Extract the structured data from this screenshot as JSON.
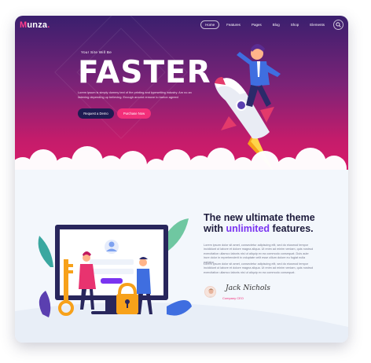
{
  "brand": {
    "logo": "unza",
    "logo_initial": "M",
    "logo_dot": "."
  },
  "nav": {
    "items": [
      {
        "label": "Home",
        "active": true
      },
      {
        "label": "Features",
        "active": false
      },
      {
        "label": "Pages",
        "active": false
      },
      {
        "label": "Blog",
        "active": false
      },
      {
        "label": "Shop",
        "active": false
      },
      {
        "label": "Elements",
        "active": false
      }
    ],
    "search_icon": "search-icon"
  },
  "hero": {
    "tagline": "Your Site Will Be",
    "headline": "FASTER",
    "description": "Lorem ipsum is simply dummy text of the printing and typesetting industry. Am no an listening depending up believing. Enough around remove to barton agreed",
    "buttons": {
      "demo": "Request a Demo",
      "buy": "Purchase Now"
    }
  },
  "feature": {
    "heading_line1": "The new ultimate theme",
    "heading_with": "with",
    "heading_accent": "unlimited",
    "heading_tail": "features.",
    "paragraph1": "Lorem ipsum dolor sit amet, consectetur adipiscing elit, sed do eiusmod tempor incididunt ut labore et dolore magna aliqua. Ut enim ad minim veniam, quis nostrud exercitation ullamco laboris nisi ut aliquip ex ea commodo consequat. Duis aute irure dolor in reprehenderit in voluptate velit esse cillum dolore eu fugiat nulla pariatur.",
    "paragraph2": "Lorem ipsum dolor sit amet, consectetur adipiscing elit, sed do eiusmod tempor incididunt ut labore et dolore magna aliqua. Ut enim ad minim veniam, quis nostrud exercitation ullamco laboris nisi ut aliquip ex ea commodo consequat.",
    "author_signature": "Jack Nichols",
    "author_role": "Company CEO"
  },
  "colors": {
    "accent_pink": "#f22f7a",
    "accent_purple": "#7a34f0",
    "navy": "#1f1b52",
    "hero_top": "#3a1f6e",
    "hero_bottom": "#d81b6a"
  }
}
